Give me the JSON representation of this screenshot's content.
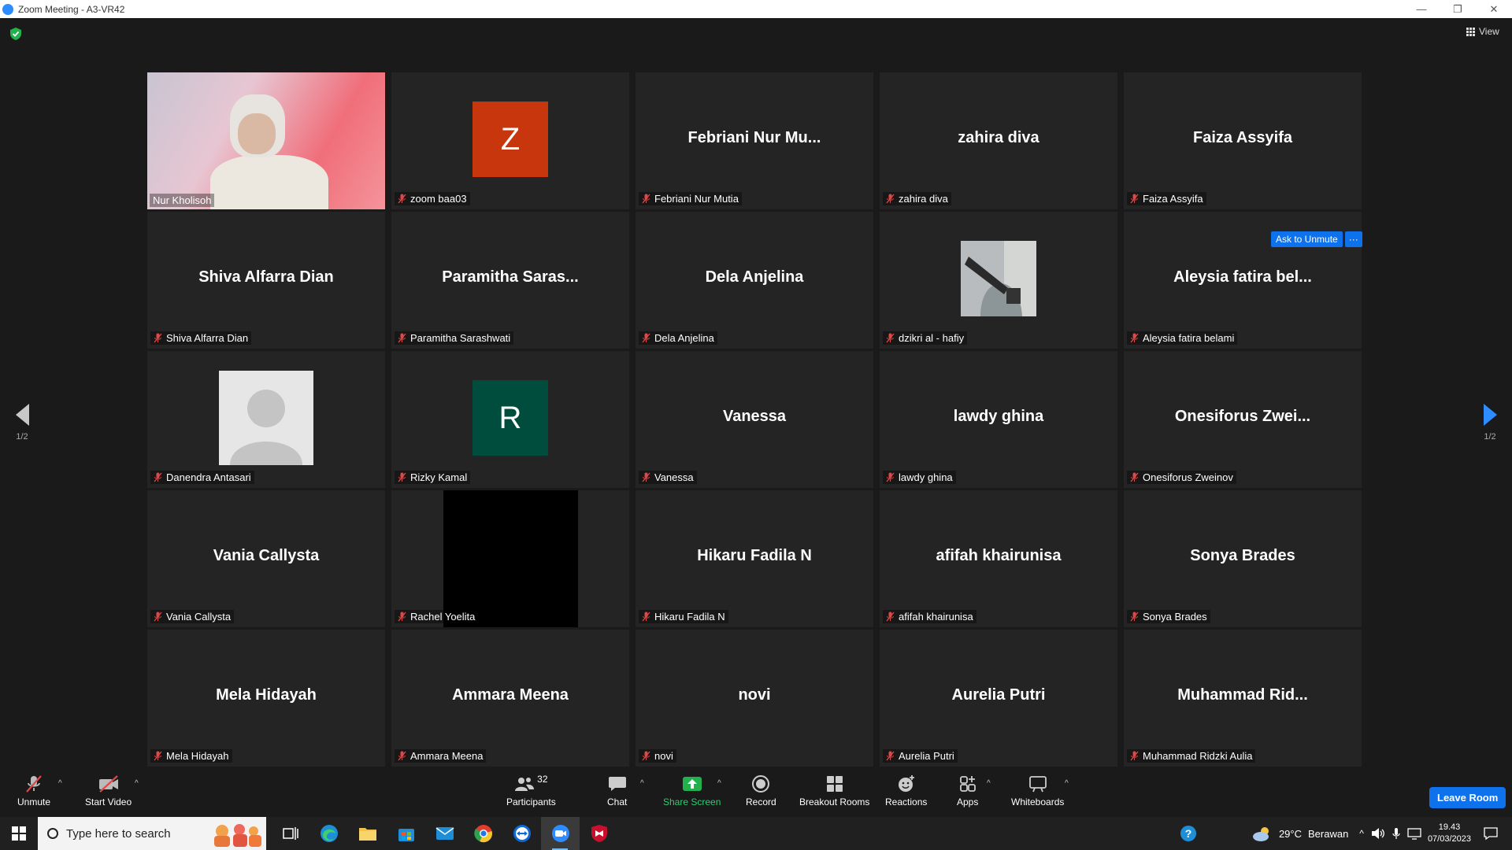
{
  "window": {
    "title": "Zoom Meeting - A3-VR42",
    "minimize": "—",
    "restore": "❐",
    "close": "✕"
  },
  "meeting": {
    "view_label": "View",
    "page_indicator": "1/2",
    "ask_unmute_label": "Ask to Unmute",
    "more_label": "···",
    "participants": [
      {
        "name": "Nur Kholisoh",
        "display": "",
        "type": "video"
      },
      {
        "name": "zoom baa03",
        "display": "",
        "type": "letter",
        "letter": "Z",
        "color": "#c8360d"
      },
      {
        "name": "Febriani Nur Mutia",
        "display": "Febriani  Nur  Mu...",
        "type": "text"
      },
      {
        "name": "zahira diva",
        "display": "zahira diva",
        "type": "text"
      },
      {
        "name": "Faiza Assyifa",
        "display": "Faiza Assyifa",
        "type": "text"
      },
      {
        "name": "Shiva Alfarra Dian",
        "display": "Shiva Alfarra Dian",
        "type": "text"
      },
      {
        "name": "Paramitha Sarashwati",
        "display": "Paramitha  Saras...",
        "type": "text"
      },
      {
        "name": "Dela Anjelina",
        "display": "Dela Anjelina",
        "type": "text"
      },
      {
        "name": "dzikri al - hafiy",
        "display": "",
        "type": "photo"
      },
      {
        "name": "Aleysia fatira belami",
        "display": "Aleysia  fatira  bel...",
        "type": "text"
      },
      {
        "name": "Danendra Antasari",
        "display": "",
        "type": "default-avatar"
      },
      {
        "name": "Rizky Kamal",
        "display": "",
        "type": "letter",
        "letter": "R",
        "color": "#004d3d"
      },
      {
        "name": "Vanessa",
        "display": "Vanessa",
        "type": "text"
      },
      {
        "name": "lawdy ghina",
        "display": "lawdy ghina",
        "type": "text"
      },
      {
        "name": "Onesiforus Zweinov",
        "display": "Onesiforus  Zwei...",
        "type": "text"
      },
      {
        "name": "Vania Callysta",
        "display": "Vania Callysta",
        "type": "text"
      },
      {
        "name": "Rachel Yoelita",
        "display": "",
        "type": "black"
      },
      {
        "name": "Hikaru Fadila N",
        "display": "Hikaru Fadila N",
        "type": "text"
      },
      {
        "name": "afifah khairunisa",
        "display": "afifah khairunisa",
        "type": "text"
      },
      {
        "name": "Sonya Brades",
        "display": "Sonya Brades",
        "type": "text"
      },
      {
        "name": "Mela Hidayah",
        "display": "Mela Hidayah",
        "type": "text"
      },
      {
        "name": "Ammara Meena",
        "display": "Ammara Meena",
        "type": "text"
      },
      {
        "name": "novi",
        "display": "novi",
        "type": "text"
      },
      {
        "name": "Aurelia Putri",
        "display": "Aurelia Putri",
        "type": "text"
      },
      {
        "name": "Muhammad Ridzki Aulia",
        "display": "Muhammad  Rid...",
        "type": "text"
      }
    ]
  },
  "toolbar": {
    "unmute": "Unmute",
    "start_video": "Start Video",
    "participants": "Participants",
    "participants_count": "32",
    "chat": "Chat",
    "share_screen": "Share Screen",
    "record": "Record",
    "breakout_rooms": "Breakout Rooms",
    "reactions": "Reactions",
    "apps": "Apps",
    "whiteboards": "Whiteboards",
    "leave": "Leave Room"
  },
  "taskbar": {
    "search_placeholder": "Type here to search",
    "temperature": "29°C",
    "weather": "Berawan",
    "time": "19.43",
    "date": "07/03/2023"
  },
  "colors": {
    "accent": "#0e72ed",
    "active_border": "#f0ec6a",
    "share_green": "#2ecc71",
    "muted_red": "#e04848"
  }
}
